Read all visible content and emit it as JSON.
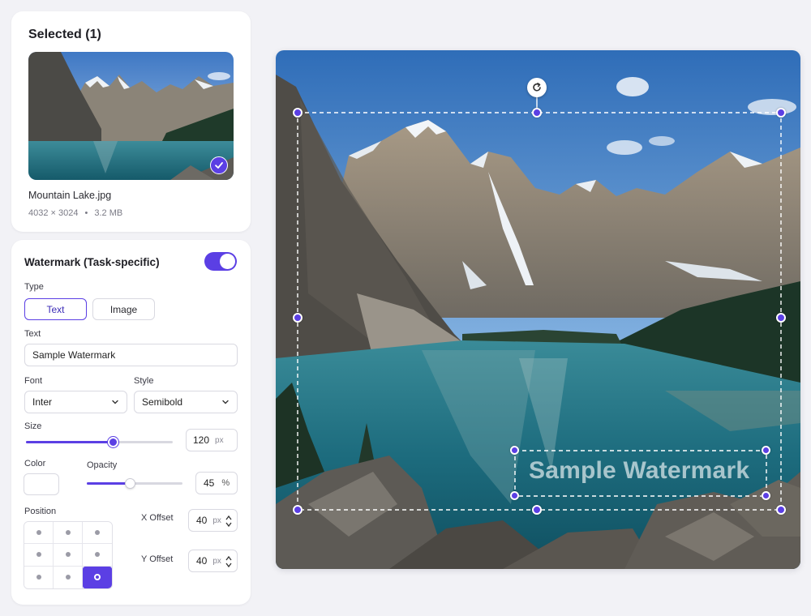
{
  "selected": {
    "title": "Selected (1)",
    "file_name": "Mountain Lake.jpg",
    "dimensions": "4032 × 3024",
    "separator": "•",
    "size": "3.2 MB"
  },
  "watermark": {
    "title": "Watermark (Task-specific)",
    "enabled": true,
    "type_label": "Type",
    "type_options": [
      "Text",
      "Image"
    ],
    "type_selected": "Text",
    "text_label": "Text",
    "text_value": "Sample Watermark",
    "font_label": "Font",
    "font_value": "Inter",
    "style_label": "Style",
    "style_value": "Semibold",
    "size_label": "Size",
    "size_value": "120",
    "size_unit": "px",
    "size_fraction": 0.59,
    "color_label": "Color",
    "color_value": "#ffffff",
    "opacity_label": "Opacity",
    "opacity_value": "45",
    "opacity_unit": "%",
    "opacity_fraction": 0.45,
    "position_label": "Position",
    "position_selected": "bottom-right",
    "x_offset_label": "X Offset",
    "x_offset_value": "40",
    "x_offset_unit": "px",
    "y_offset_label": "Y Offset",
    "y_offset_value": "40",
    "y_offset_unit": "px"
  },
  "canvas": {
    "watermark_text": "Sample Watermark"
  },
  "colors": {
    "accent": "#5b3fe4",
    "panel": "#ffffff",
    "background": "#f2f2f6"
  }
}
